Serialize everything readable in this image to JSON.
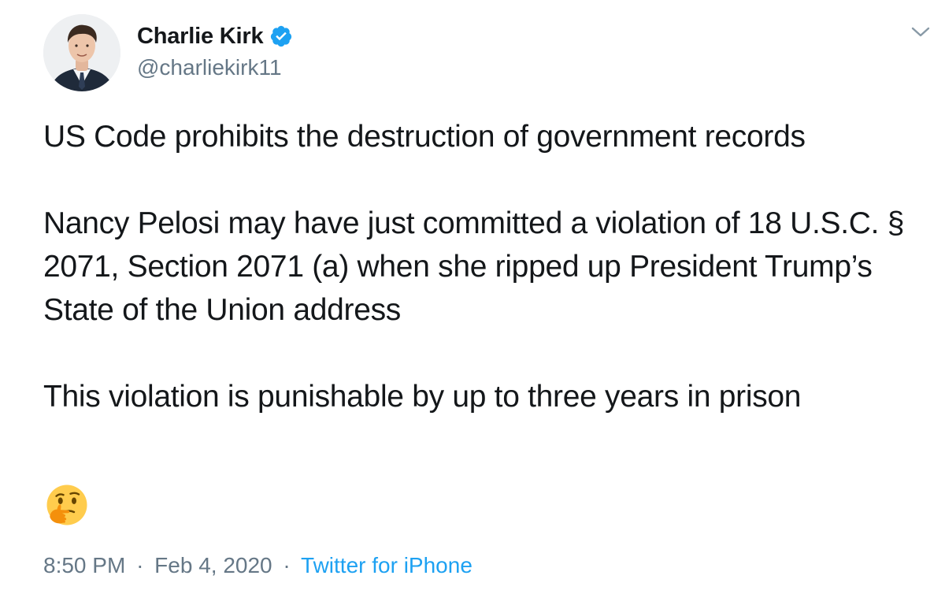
{
  "author": {
    "display_name": "Charlie Kirk",
    "handle": "@charliekirk11",
    "verified": true
  },
  "tweet": {
    "lines": [
      "US Code prohibits the destruction of government records",
      "Nancy Pelosi may have just committed a violation of 18 U.S.C. § 2071, Section 2071 (a) when she ripped up President Trump’s State of the Union address",
      "This violation is punishable by up to three years in prison"
    ],
    "emoji": "thinking-face-icon"
  },
  "meta": {
    "time": "8:50 PM",
    "separator": "·",
    "date": "Feb 4, 2020",
    "source": "Twitter for iPhone"
  },
  "colors": {
    "text": "#14171a",
    "secondary": "#657786",
    "accent": "#1da1f2"
  },
  "icons": {
    "menu": "chevron-down-icon",
    "verified": "verified-badge-icon"
  }
}
